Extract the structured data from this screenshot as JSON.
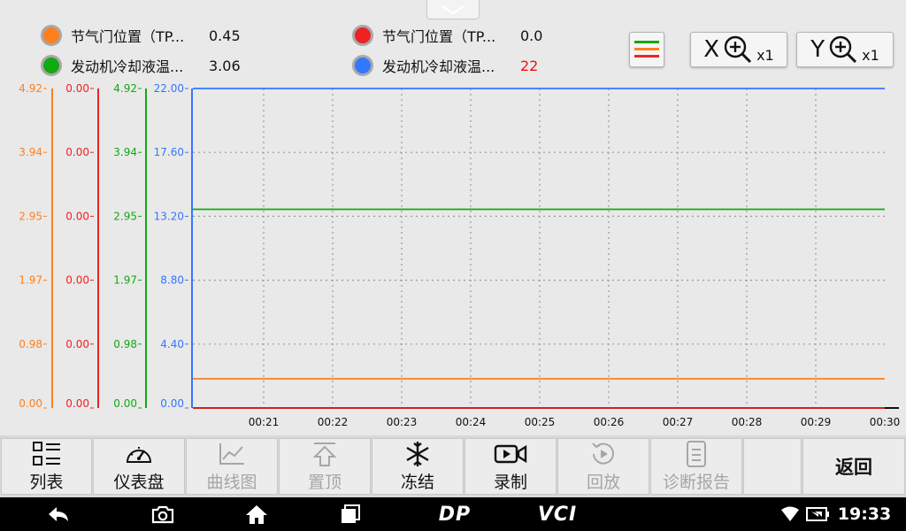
{
  "legend": {
    "items": [
      {
        "name": "节气门位置（TP...",
        "value": "0.45",
        "color": "#ff7f1e"
      },
      {
        "name": "发动机冷却液温...",
        "value": "3.06",
        "color": "#11aa11"
      },
      {
        "name": "节气门位置（TP...",
        "value": "0.0",
        "color": "#ee2222"
      },
      {
        "name": "发动机冷却液温...",
        "value": "22",
        "color": "#3377ff"
      }
    ]
  },
  "toolbar": {
    "x_zoom": {
      "letter": "X",
      "level": "x1"
    },
    "y_zoom": {
      "letter": "Y",
      "level": "x1"
    }
  },
  "chart_data": {
    "type": "line",
    "x": [
      "00:21",
      "00:22",
      "00:23",
      "00:24",
      "00:25",
      "00:26",
      "00:27",
      "00:28",
      "00:29",
      "00:30"
    ],
    "axes": [
      {
        "color": "#ff7f1e",
        "ticks": [
          "4.92",
          "3.94",
          "2.95",
          "1.97",
          "0.98",
          "0.00"
        ],
        "ylim": [
          0,
          4.92
        ]
      },
      {
        "color": "#ee2222",
        "ticks": [
          "0.00",
          "0.00",
          "0.00",
          "0.00",
          "0.00",
          "0.00"
        ],
        "ylim": [
          0,
          0
        ]
      },
      {
        "color": "#11aa11",
        "ticks": [
          "4.92",
          "3.94",
          "2.95",
          "1.97",
          "0.98",
          "0.00"
        ],
        "ylim": [
          0,
          4.92
        ]
      },
      {
        "color": "#3377ff",
        "ticks": [
          "22.00",
          "17.60",
          "13.20",
          "8.80",
          "4.40",
          "0.00"
        ],
        "ylim": [
          0,
          22
        ]
      }
    ],
    "series": [
      {
        "axis": 0,
        "color": "#ff7f1e",
        "values": [
          0.45,
          0.45,
          0.45,
          0.45,
          0.45,
          0.45,
          0.45,
          0.45,
          0.45,
          0.45
        ]
      },
      {
        "axis": 1,
        "color": "#ee2222",
        "values": [
          0,
          0,
          0,
          0,
          0,
          0,
          0,
          0,
          0,
          0
        ]
      },
      {
        "axis": 2,
        "color": "#11aa11",
        "values": [
          3.06,
          3.06,
          3.06,
          3.06,
          3.06,
          3.06,
          3.06,
          3.06,
          3.06,
          3.06
        ]
      },
      {
        "axis": 3,
        "color": "#3377ff",
        "values": [
          22,
          22,
          22,
          22,
          22,
          22,
          22,
          22,
          22,
          22
        ]
      }
    ],
    "grid": true
  },
  "actions": [
    {
      "label": "列表",
      "icon": "list-icon",
      "enabled": true
    },
    {
      "label": "仪表盘",
      "icon": "gauge-icon",
      "enabled": true
    },
    {
      "label": "曲线图",
      "icon": "line-chart-icon",
      "enabled": false
    },
    {
      "label": "置顶",
      "icon": "pin-top-icon",
      "enabled": false
    },
    {
      "label": "冻结",
      "icon": "snowflake-icon",
      "enabled": true
    },
    {
      "label": "录制",
      "icon": "video-record-icon",
      "enabled": true
    },
    {
      "label": "回放",
      "icon": "playback-icon",
      "enabled": false
    },
    {
      "label": "诊断报告",
      "icon": "report-icon",
      "enabled": false
    }
  ],
  "back_label": "返回",
  "navbar": {
    "brand1": "DP",
    "brand2": "VCI",
    "time": "19:33"
  }
}
